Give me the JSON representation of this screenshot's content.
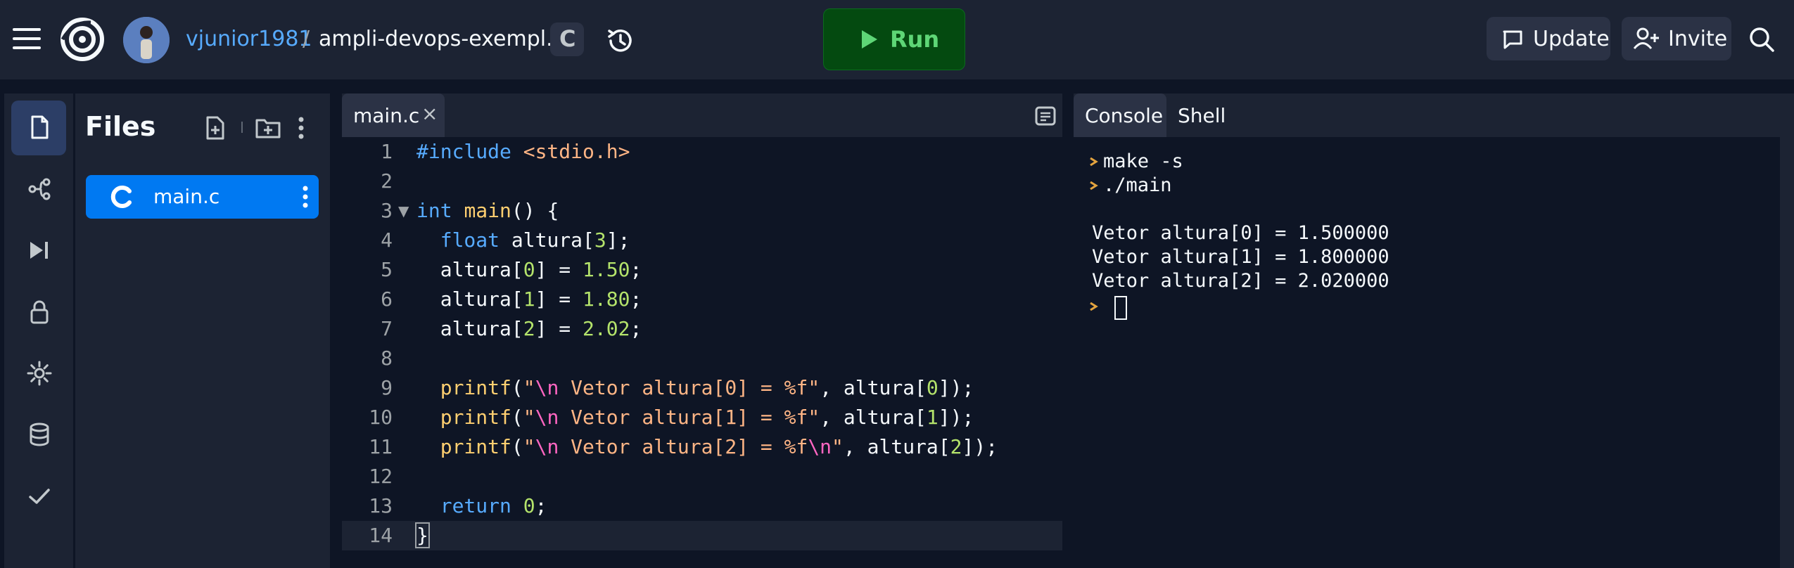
{
  "header": {
    "username": "vjunior1981",
    "separator": "/",
    "repl_name": "ampli-devops-exempl...",
    "lang_badge": "C",
    "run_label": "Run",
    "update_label": "Update",
    "invite_label": "Invite"
  },
  "files": {
    "title": "Files",
    "items": [
      {
        "icon": "c-language-icon",
        "name": "main.c"
      }
    ]
  },
  "editor": {
    "tab_label": "main.c",
    "tab_close": "×",
    "lines": [
      {
        "n": "1",
        "text": "#include <stdio.h>"
      },
      {
        "n": "2",
        "text": ""
      },
      {
        "n": "3",
        "text": "int main() {"
      },
      {
        "n": "4",
        "text": "  float altura[3];"
      },
      {
        "n": "5",
        "text": "  altura[0] = 1.50;"
      },
      {
        "n": "6",
        "text": "  altura[1] = 1.80;"
      },
      {
        "n": "7",
        "text": "  altura[2] = 2.02;"
      },
      {
        "n": "8",
        "text": ""
      },
      {
        "n": "9",
        "text": "  printf(\"\\n Vetor altura[0] = %f\", altura[0]);"
      },
      {
        "n": "10",
        "text": "  printf(\"\\n Vetor altura[1] = %f\", altura[1]);"
      },
      {
        "n": "11",
        "text": "  printf(\"\\n Vetor altura[2] = %f\\n\", altura[2]);"
      },
      {
        "n": "12",
        "text": ""
      },
      {
        "n": "13",
        "text": "  return 0;"
      },
      {
        "n": "14",
        "text": "}"
      }
    ]
  },
  "console": {
    "tabs": [
      "Console",
      "Shell"
    ],
    "commands": [
      "make -s",
      "./main"
    ],
    "output": [
      "Vetor altura[0] = 1.500000",
      "Vetor altura[1] = 1.800000",
      "Vetor altura[2] = 2.020000"
    ]
  },
  "colors": {
    "accent": "#0079f2",
    "run_green": "#5ed676",
    "background": "#0e1525",
    "surface": "#1c2333"
  }
}
